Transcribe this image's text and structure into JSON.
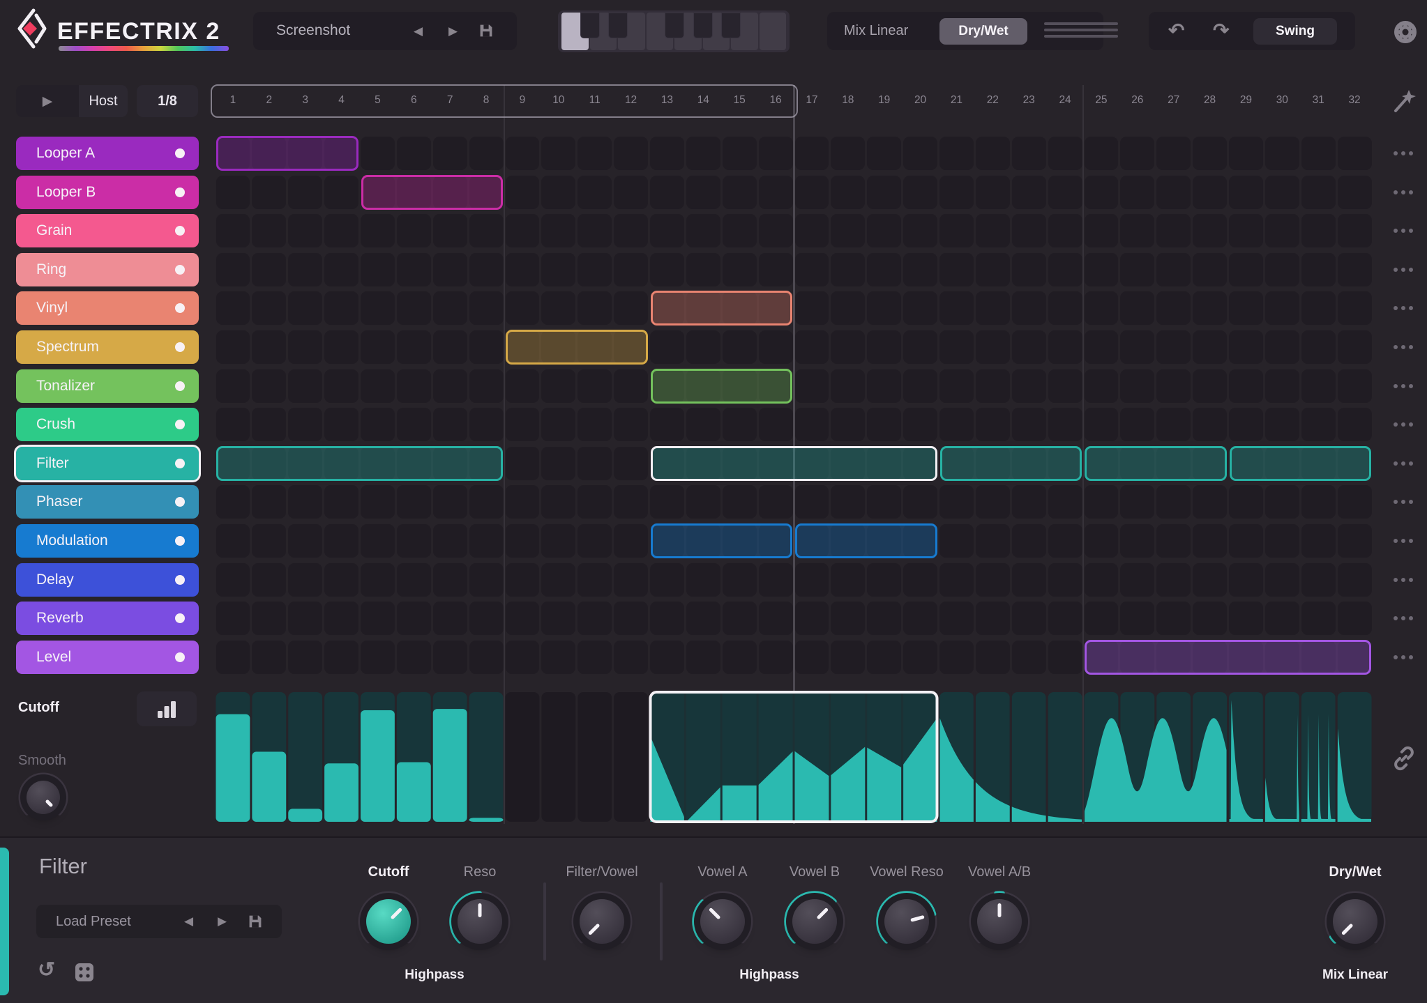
{
  "app": {
    "title": "EFFECTRIX 2"
  },
  "top_bar": {
    "preset": {
      "name": "Screenshot"
    },
    "pattern_keyboard": {
      "white_keys": 8,
      "selected_key": 1,
      "black_key_positions": [
        1,
        2,
        4,
        5,
        6
      ]
    },
    "mix": {
      "label": "Mix Linear",
      "mode_button": "Dry/Wet"
    },
    "swing_button": "Swing"
  },
  "transport": {
    "host_button": "Host",
    "rate": "1/8"
  },
  "sequencer": {
    "steps": 32,
    "loop_start": 1,
    "loop_end": 16,
    "step_numbers": [
      "1",
      "2",
      "3",
      "4",
      "5",
      "6",
      "7",
      "8",
      "9",
      "10",
      "11",
      "12",
      "13",
      "14",
      "15",
      "16",
      "17",
      "18",
      "19",
      "20",
      "21",
      "22",
      "23",
      "24",
      "25",
      "26",
      "27",
      "28",
      "29",
      "30",
      "31",
      "32"
    ],
    "tracks": [
      {
        "name": "Looper A",
        "color": "#9a2abf"
      },
      {
        "name": "Looper B",
        "color": "#cb2da6"
      },
      {
        "name": "Grain",
        "color": "#f4598f"
      },
      {
        "name": "Ring",
        "color": "#ee8d95"
      },
      {
        "name": "Vinyl",
        "color": "#e98471"
      },
      {
        "name": "Spectrum",
        "color": "#d6a947"
      },
      {
        "name": "Tonalizer",
        "color": "#74c25d"
      },
      {
        "name": "Crush",
        "color": "#2dcb88"
      },
      {
        "name": "Filter",
        "color": "#27b2a4",
        "selected": true
      },
      {
        "name": "Phaser",
        "color": "#3390b5"
      },
      {
        "name": "Modulation",
        "color": "#177bd0"
      },
      {
        "name": "Delay",
        "color": "#3d51d9"
      },
      {
        "name": "Reverb",
        "color": "#7b4de1"
      },
      {
        "name": "Level",
        "color": "#a356e3"
      }
    ],
    "blocks": [
      {
        "track": "Looper A",
        "start": 1,
        "end": 4
      },
      {
        "track": "Looper B",
        "start": 5,
        "end": 8
      },
      {
        "track": "Vinyl",
        "start": 13,
        "end": 16
      },
      {
        "track": "Spectrum",
        "start": 9,
        "end": 12
      },
      {
        "track": "Tonalizer",
        "start": 13,
        "end": 16
      },
      {
        "track": "Filter",
        "start": 1,
        "end": 8
      },
      {
        "track": "Filter",
        "start": 13,
        "end": 20,
        "selected": true
      },
      {
        "track": "Filter",
        "start": 21,
        "end": 24
      },
      {
        "track": "Filter",
        "start": 25,
        "end": 28
      },
      {
        "track": "Filter",
        "start": 29,
        "end": 32
      },
      {
        "track": "Modulation",
        "start": 13,
        "end": 16
      },
      {
        "track": "Modulation",
        "start": 17,
        "end": 20
      },
      {
        "track": "Level",
        "start": 25,
        "end": 32
      }
    ]
  },
  "automation": {
    "parameter_label": "Cutoff",
    "smooth_label": "Smooth",
    "color": "#2bbab0",
    "segments": [
      {
        "type": "bars",
        "start": 1,
        "end": 8,
        "values": [
          0.83,
          0.54,
          0.1,
          0.45,
          0.86,
          0.46,
          0.87,
          0.03
        ]
      },
      {
        "type": "empty",
        "start": 9,
        "end": 12
      },
      {
        "type": "polyline",
        "start": 13,
        "end": 20,
        "selected": true,
        "boundary_values": [
          0.66,
          0.0,
          0.28,
          0.28,
          0.55,
          0.35,
          0.58,
          0.42,
          0.8
        ]
      },
      {
        "type": "decay",
        "start": 21,
        "end": 24,
        "from": 0.8,
        "to": 0.02
      },
      {
        "type": "bells",
        "start": 25,
        "end": 28,
        "peak_positions": [
          0.19,
          0.55,
          0.91
        ],
        "peak_height": 0.8,
        "width": 0.24
      },
      {
        "type": "spikes",
        "start": 29,
        "end": 32,
        "spikes": [
          [
            0.015,
            0.94,
            0.2
          ],
          [
            0.255,
            0.34,
            0.13
          ],
          [
            0.48,
            0.83,
            0.025
          ],
          [
            0.555,
            0.83,
            0.025
          ],
          [
            0.63,
            0.83,
            0.025
          ],
          [
            0.7,
            0.83,
            0.025
          ],
          [
            0.765,
            0.72,
            0.23
          ]
        ]
      }
    ]
  },
  "editor": {
    "title": "Filter",
    "preset_button": "Load Preset",
    "highpass_label": "Highpass",
    "knobs": [
      {
        "label": "Cutoff",
        "angle": 45,
        "teal_face": true,
        "bold": true
      },
      {
        "label": "Reso",
        "angle": 0,
        "arc": [
          -135,
          0
        ]
      },
      {
        "label": "Filter/Vowel",
        "angle": -135,
        "divider_before": true
      },
      {
        "label": "Vowel A",
        "angle": -45,
        "arc": [
          -135,
          -45
        ],
        "divider_before": true
      },
      {
        "label": "Vowel B",
        "angle": 45,
        "arc": [
          -135,
          45
        ]
      },
      {
        "label": "Vowel Reso",
        "angle": 75,
        "arc": [
          -135,
          75
        ]
      },
      {
        "label": "Vowel A/B",
        "angle": 0,
        "arc": [
          -7,
          7
        ]
      },
      {
        "label": "Dry/Wet",
        "angle": -135,
        "arc": [
          -135,
          -123
        ],
        "bold": true,
        "sublabel": "Mix Linear"
      }
    ]
  }
}
